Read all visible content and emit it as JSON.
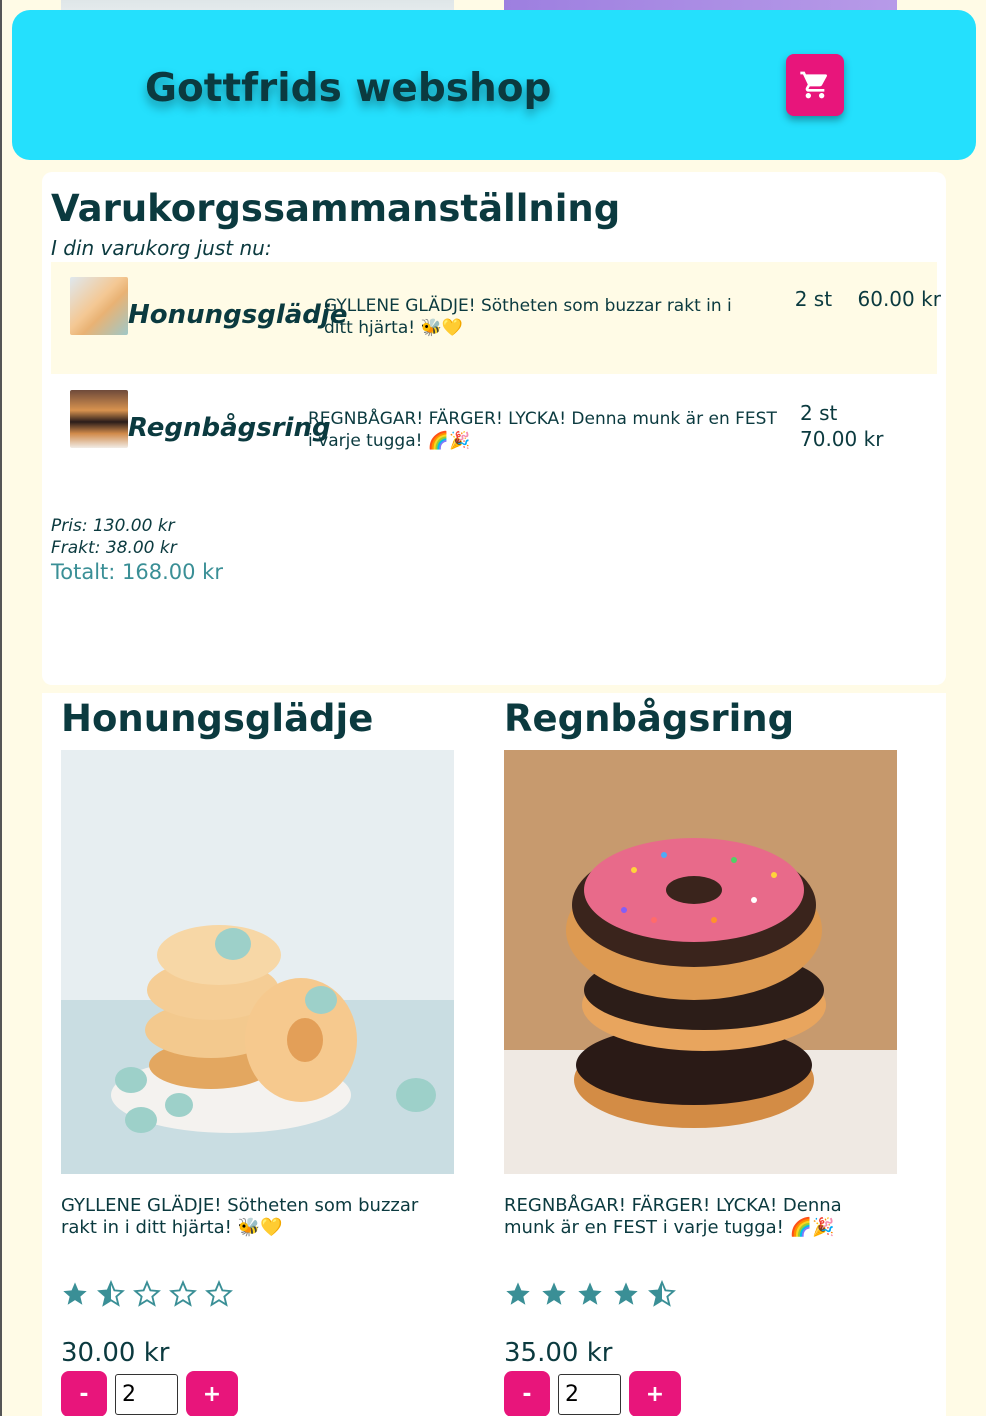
{
  "header": {
    "title": "Gottfrids webshop",
    "cart_icon": "cart-icon",
    "accent": "#24e0fd",
    "button_color": "#e8157b"
  },
  "summary": {
    "title": "Varukorgssammanställning",
    "subtitle": "I din varukorg just nu:",
    "items": [
      {
        "name": "Honungsglädje",
        "description": "GYLLENE GLÄDJE! Sötheten som buzzar rakt in i ditt hjärta! 🐝💛",
        "quantity": "2 st",
        "price": "60.00 kr"
      },
      {
        "name": "Regnbågsring",
        "description": "REGNBÅGAR! FÄRGER! LYCKA! Denna munk är en FEST i varje tugga! 🌈🎉",
        "quantity": "2 st",
        "price": "70.00 kr"
      }
    ],
    "price_line": "Pris: 130.00 kr",
    "shipping_line": "Frakt: 38.00 kr",
    "total_line": "Totalt: 168.00 kr"
  },
  "products": [
    {
      "name": "Honungsglädje",
      "description": "GYLLENE GLÄDJE! Sötheten som buzzar rakt in i ditt hjärta! 🐝💛",
      "rating": 1.5,
      "price": "30.00 kr",
      "quantity": "2",
      "minus_label": "-",
      "plus_label": "+"
    },
    {
      "name": "Regnbågsring",
      "description": "REGNBÅGAR! FÄRGER! LYCKA! Denna munk är en FEST i varje tugga! 🌈🎉",
      "rating": 4.5,
      "price": "35.00 kr",
      "quantity": "2",
      "minus_label": "-",
      "plus_label": "+"
    }
  ]
}
